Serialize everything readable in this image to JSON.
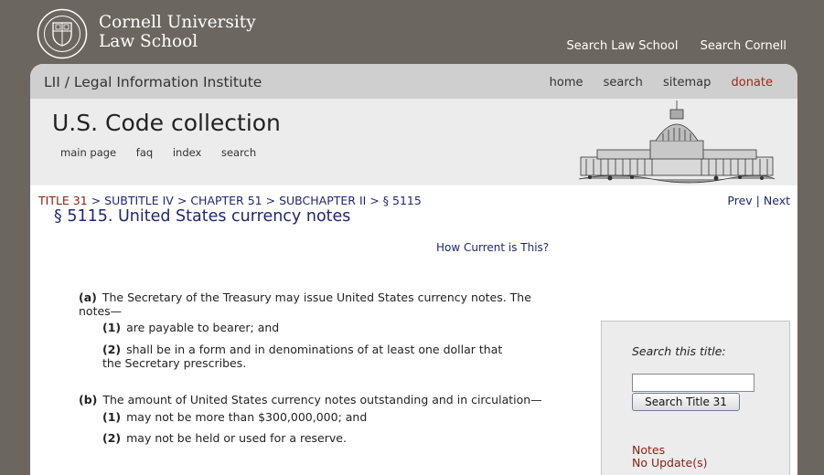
{
  "header": {
    "university_line1": "Cornell University",
    "university_line2": "Law School",
    "links": [
      "Search Law School",
      "Search Cornell"
    ]
  },
  "lii": {
    "title": "LII / Legal Information Institute",
    "nav": [
      "home",
      "search",
      "sitemap",
      "donate"
    ]
  },
  "collection": {
    "title": "U.S. Code collection",
    "nav": [
      "main page",
      "faq",
      "index",
      "search"
    ]
  },
  "breadcrumb": {
    "title": "TITLE 31",
    "sep": ">",
    "subtitle": "SUBTITLE IV",
    "chapter": "CHAPTER 51",
    "subchapter": "SUBCHAPTER II",
    "section": "§ 5115"
  },
  "pager": {
    "prev": "Prev",
    "divider": "|",
    "next": "Next"
  },
  "section": {
    "heading": "§ 5115. United States currency notes",
    "how_current": "How Current is This?"
  },
  "paragraphs": {
    "a": {
      "label": "(a)",
      "text": "The Secretary of the Treasury may issue United States currency notes. The notes—"
    },
    "a1": {
      "label": "(1)",
      "text": "are payable to bearer; and"
    },
    "a2": {
      "label": "(2)",
      "text": "shall be in a form and in denominations of at least one dollar that the Secretary prescribes."
    },
    "b": {
      "label": "(b)",
      "text": "The amount of United States currency notes outstanding and in circulation—"
    },
    "b1": {
      "label": "(1)",
      "text": "may not be more than $300,000,000; and"
    },
    "b2": {
      "label": "(2)",
      "text": "may not be held or used for a reserve."
    }
  },
  "search_title": {
    "label": "Search this title:",
    "input_value": "",
    "button": "Search Title 31"
  },
  "notes": {
    "title": "Notes",
    "update": "No Update(s)"
  },
  "colors": {
    "background": "#6b6760",
    "link_blue": "#1e2770",
    "dark_red": "#8a1e10"
  }
}
